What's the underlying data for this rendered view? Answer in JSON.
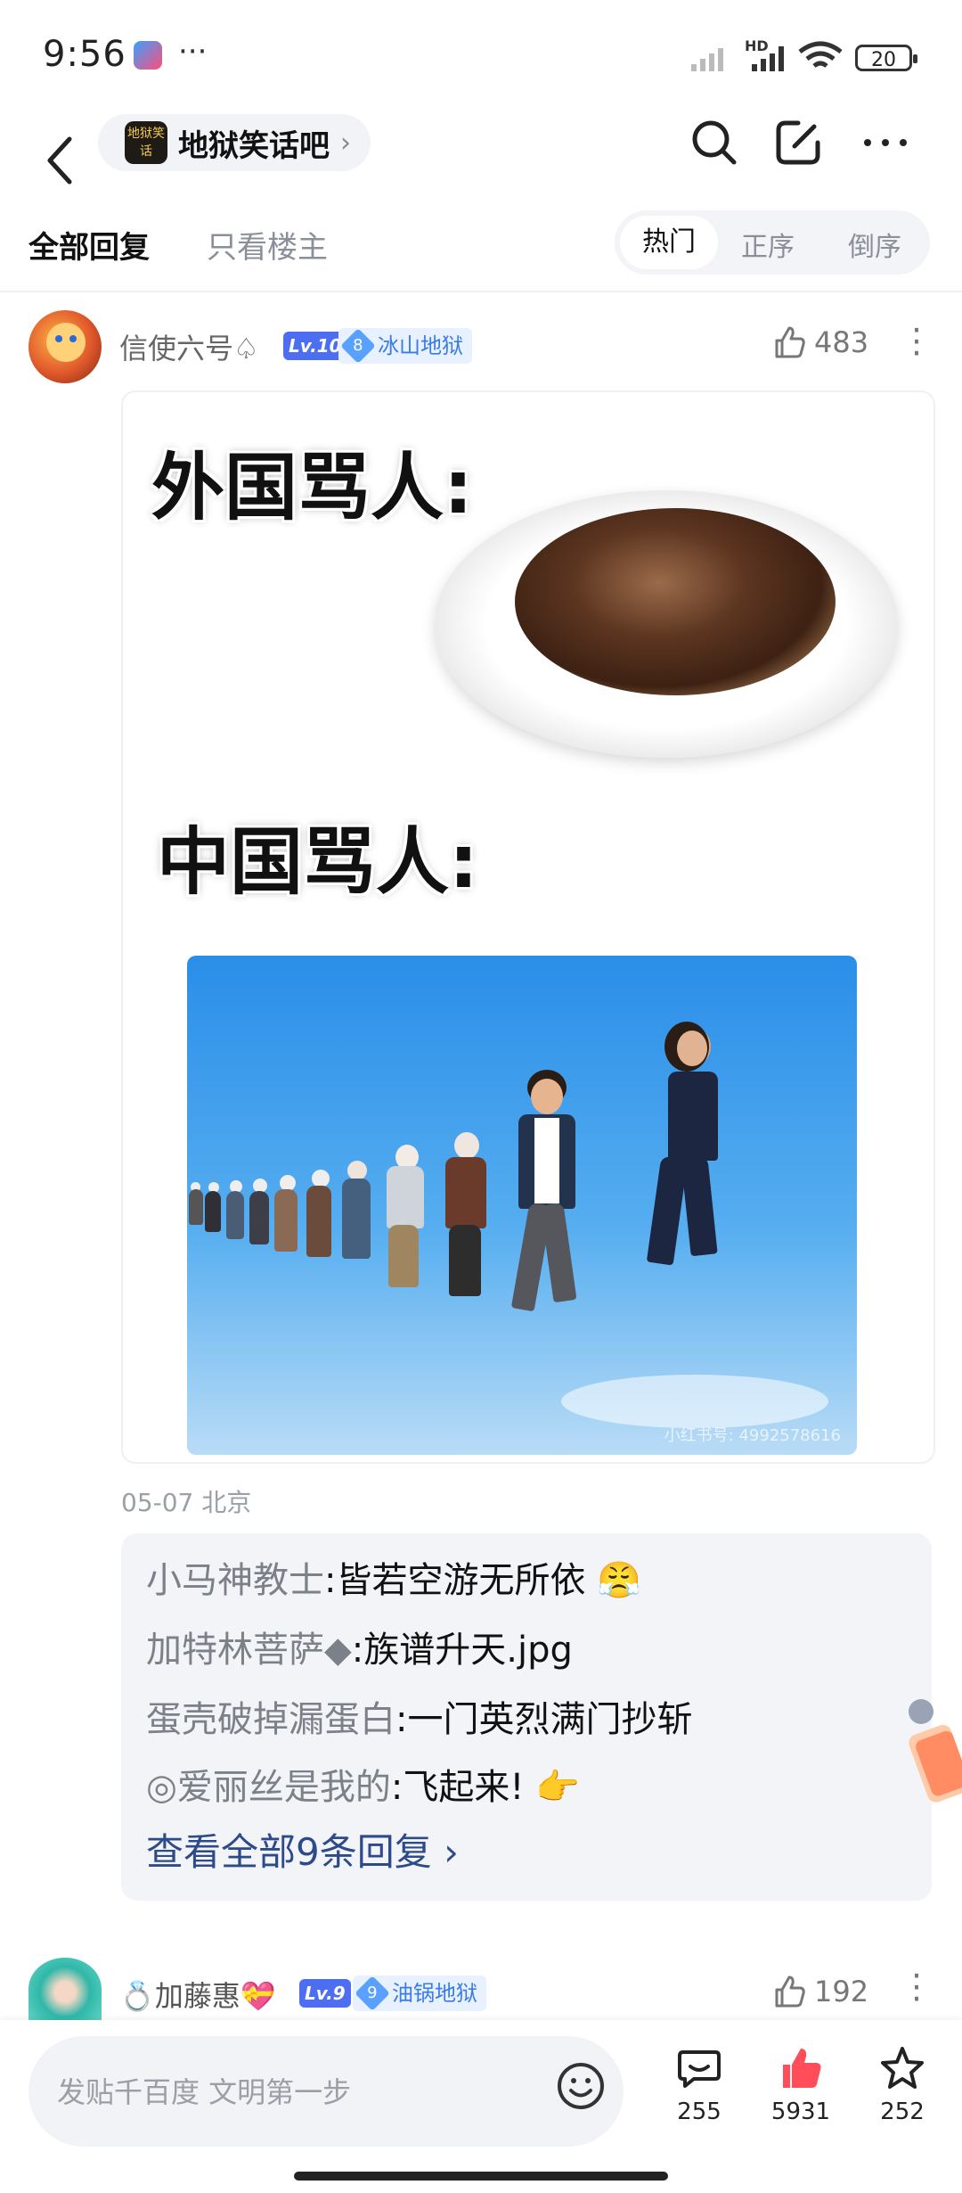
{
  "status_bar": {
    "time": "9:56",
    "more": "···",
    "hd": "HD",
    "battery": "20"
  },
  "header": {
    "forum_name": "地狱笑话吧",
    "forum_logo_text": "地狱笑话",
    "chevron": "›"
  },
  "tabs": {
    "all_replies": "全部回复",
    "owner_only": "只看楼主",
    "sort": [
      "热门",
      "正序",
      "倒序"
    ]
  },
  "post": {
    "author": "信使六号♤",
    "level": "Lv.10",
    "tag_num": "8",
    "tag_name": "冰山地狱",
    "likes": "483",
    "more": "⋮",
    "meme_caption_1": "外国骂人:",
    "meme_caption_2": "中国骂人:",
    "meme_watermark": "小红书号: 4992578616",
    "date_location": "05-07 北京"
  },
  "replies": [
    {
      "name": "小马神教士",
      "sep": ":",
      "text": "皆若空游无所依 😤"
    },
    {
      "name": "加特林菩萨◆",
      "sep": ":",
      "text": "族谱升天.jpg"
    },
    {
      "name": "蛋壳破掉漏蛋白",
      "sep": ":",
      "text": "一门英烈满门抄斩"
    },
    {
      "name": "◎爱丽丝是我的",
      "sep": ":",
      "text": "飞起来! 👉"
    }
  ],
  "view_all": "查看全部9条回复 ›",
  "next_post": {
    "author": "💍加藤惠💝",
    "level": "Lv.9",
    "tag_num": "9",
    "tag_name": "油锅地狱",
    "likes": "192",
    "more": "⋮"
  },
  "bottom": {
    "input_placeholder": "发贴千百度 文明第一步",
    "reply_count": "255",
    "like_count": "5931",
    "fav_count": "252"
  },
  "colors": {
    "accent": "#4e6ef2",
    "tag_bg": "#e8f1ff",
    "like_red": "#ff4d5a"
  }
}
